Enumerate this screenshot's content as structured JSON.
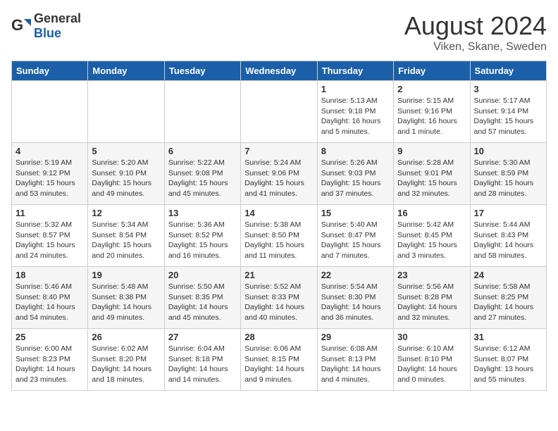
{
  "header": {
    "logo_general": "General",
    "logo_blue": "Blue",
    "title": "August 2024",
    "subtitle": "Viken, Skane, Sweden"
  },
  "weekdays": [
    "Sunday",
    "Monday",
    "Tuesday",
    "Wednesday",
    "Thursday",
    "Friday",
    "Saturday"
  ],
  "weeks": [
    [
      {
        "day": "",
        "info": ""
      },
      {
        "day": "",
        "info": ""
      },
      {
        "day": "",
        "info": ""
      },
      {
        "day": "",
        "info": ""
      },
      {
        "day": "1",
        "info": "Sunrise: 5:13 AM\nSunset: 9:18 PM\nDaylight: 16 hours\nand 5 minutes."
      },
      {
        "day": "2",
        "info": "Sunrise: 5:15 AM\nSunset: 9:16 PM\nDaylight: 16 hours\nand 1 minute."
      },
      {
        "day": "3",
        "info": "Sunrise: 5:17 AM\nSunset: 9:14 PM\nDaylight: 15 hours\nand 57 minutes."
      }
    ],
    [
      {
        "day": "4",
        "info": "Sunrise: 5:19 AM\nSunset: 9:12 PM\nDaylight: 15 hours\nand 53 minutes."
      },
      {
        "day": "5",
        "info": "Sunrise: 5:20 AM\nSunset: 9:10 PM\nDaylight: 15 hours\nand 49 minutes."
      },
      {
        "day": "6",
        "info": "Sunrise: 5:22 AM\nSunset: 9:08 PM\nDaylight: 15 hours\nand 45 minutes."
      },
      {
        "day": "7",
        "info": "Sunrise: 5:24 AM\nSunset: 9:06 PM\nDaylight: 15 hours\nand 41 minutes."
      },
      {
        "day": "8",
        "info": "Sunrise: 5:26 AM\nSunset: 9:03 PM\nDaylight: 15 hours\nand 37 minutes."
      },
      {
        "day": "9",
        "info": "Sunrise: 5:28 AM\nSunset: 9:01 PM\nDaylight: 15 hours\nand 32 minutes."
      },
      {
        "day": "10",
        "info": "Sunrise: 5:30 AM\nSunset: 8:59 PM\nDaylight: 15 hours\nand 28 minutes."
      }
    ],
    [
      {
        "day": "11",
        "info": "Sunrise: 5:32 AM\nSunset: 8:57 PM\nDaylight: 15 hours\nand 24 minutes."
      },
      {
        "day": "12",
        "info": "Sunrise: 5:34 AM\nSunset: 8:54 PM\nDaylight: 15 hours\nand 20 minutes."
      },
      {
        "day": "13",
        "info": "Sunrise: 5:36 AM\nSunset: 8:52 PM\nDaylight: 15 hours\nand 16 minutes."
      },
      {
        "day": "14",
        "info": "Sunrise: 5:38 AM\nSunset: 8:50 PM\nDaylight: 15 hours\nand 11 minutes."
      },
      {
        "day": "15",
        "info": "Sunrise: 5:40 AM\nSunset: 8:47 PM\nDaylight: 15 hours\nand 7 minutes."
      },
      {
        "day": "16",
        "info": "Sunrise: 5:42 AM\nSunset: 8:45 PM\nDaylight: 15 hours\nand 3 minutes."
      },
      {
        "day": "17",
        "info": "Sunrise: 5:44 AM\nSunset: 8:43 PM\nDaylight: 14 hours\nand 58 minutes."
      }
    ],
    [
      {
        "day": "18",
        "info": "Sunrise: 5:46 AM\nSunset: 8:40 PM\nDaylight: 14 hours\nand 54 minutes."
      },
      {
        "day": "19",
        "info": "Sunrise: 5:48 AM\nSunset: 8:38 PM\nDaylight: 14 hours\nand 49 minutes."
      },
      {
        "day": "20",
        "info": "Sunrise: 5:50 AM\nSunset: 8:35 PM\nDaylight: 14 hours\nand 45 minutes."
      },
      {
        "day": "21",
        "info": "Sunrise: 5:52 AM\nSunset: 8:33 PM\nDaylight: 14 hours\nand 40 minutes."
      },
      {
        "day": "22",
        "info": "Sunrise: 5:54 AM\nSunset: 8:30 PM\nDaylight: 14 hours\nand 36 minutes."
      },
      {
        "day": "23",
        "info": "Sunrise: 5:56 AM\nSunset: 8:28 PM\nDaylight: 14 hours\nand 32 minutes."
      },
      {
        "day": "24",
        "info": "Sunrise: 5:58 AM\nSunset: 8:25 PM\nDaylight: 14 hours\nand 27 minutes."
      }
    ],
    [
      {
        "day": "25",
        "info": "Sunrise: 6:00 AM\nSunset: 8:23 PM\nDaylight: 14 hours\nand 23 minutes."
      },
      {
        "day": "26",
        "info": "Sunrise: 6:02 AM\nSunset: 8:20 PM\nDaylight: 14 hours\nand 18 minutes."
      },
      {
        "day": "27",
        "info": "Sunrise: 6:04 AM\nSunset: 8:18 PM\nDaylight: 14 hours\nand 14 minutes."
      },
      {
        "day": "28",
        "info": "Sunrise: 6:06 AM\nSunset: 8:15 PM\nDaylight: 14 hours\nand 9 minutes."
      },
      {
        "day": "29",
        "info": "Sunrise: 6:08 AM\nSunset: 8:13 PM\nDaylight: 14 hours\nand 4 minutes."
      },
      {
        "day": "30",
        "info": "Sunrise: 6:10 AM\nSunset: 8:10 PM\nDaylight: 14 hours\nand 0 minutes."
      },
      {
        "day": "31",
        "info": "Sunrise: 6:12 AM\nSunset: 8:07 PM\nDaylight: 13 hours\nand 55 minutes."
      }
    ]
  ]
}
